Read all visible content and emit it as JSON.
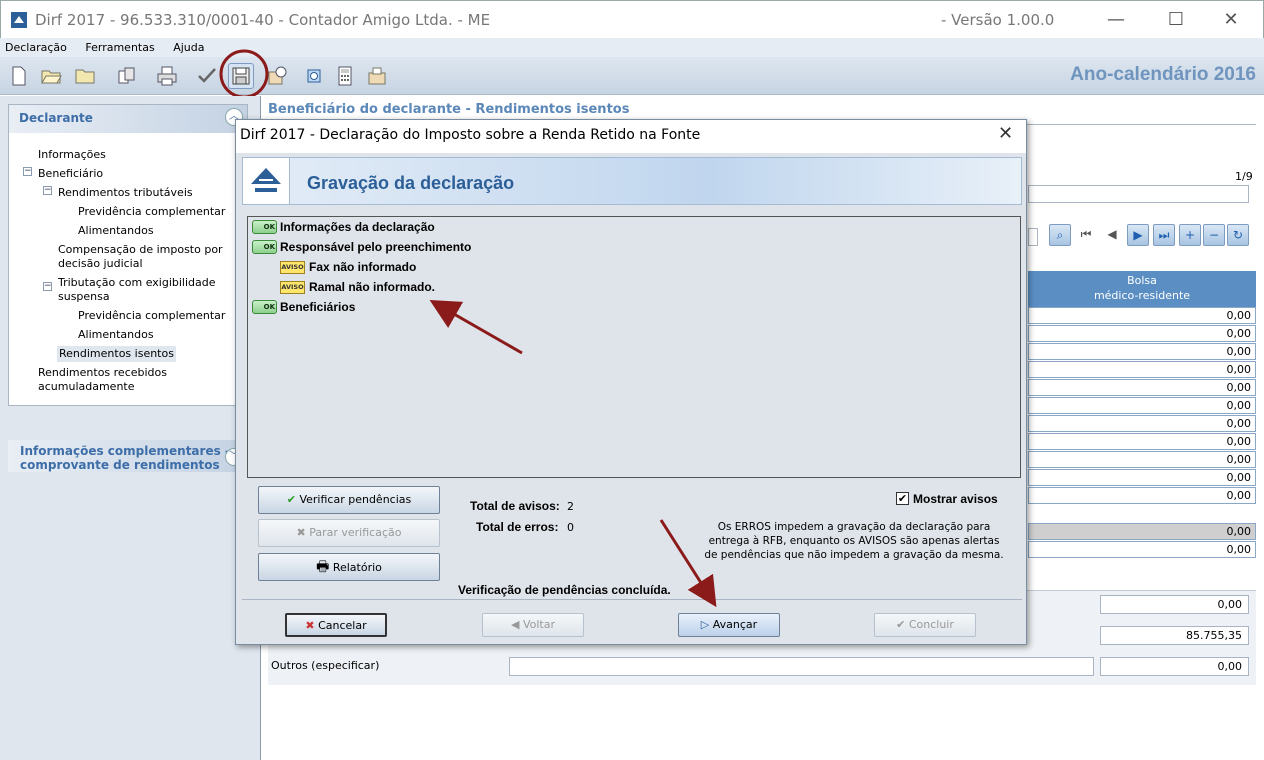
{
  "window": {
    "title": "Dirf 2017 - 96.533.310/0001-40 - Contador Amigo Ltda. - ME",
    "version": "- Versão  1.00.0",
    "minimize": "—",
    "maximize": "☐",
    "close": "✕"
  },
  "menu": [
    "Declaração",
    "Ferramentas",
    "Ajuda"
  ],
  "toolbar": {
    "year_label": "Ano-calendário 2016",
    "icons": [
      "new-file-icon",
      "open-folder-icon",
      "folder-icon",
      "copy-icon",
      "print-icon",
      "check-icon",
      "save-icon",
      "export-icon",
      "search-icon",
      "calculator-icon",
      "transmit-icon"
    ]
  },
  "sidebar": {
    "declarante_header": "Declarante",
    "tree": [
      "Informações",
      "Beneficiário",
      "Rendimentos tributáveis",
      "Previdência complementar",
      "Alimentandos",
      "Compensação de imposto por",
      "decisão judicial",
      "Tributação com exigibilidade",
      "suspensa",
      "Previdência complementar",
      "Alimentandos",
      "Rendimentos isentos",
      "Rendimentos recebidos",
      "acumuladamente"
    ],
    "info_header_line1": "Informações complementares -",
    "info_header_line2": "comprovante de rendimentos"
  },
  "background": {
    "heading": "Beneficiário do declarante - Rendimentos isentos",
    "page_counter": "1/9",
    "column_header_line1": "Bolsa",
    "column_header_line2": "médico-residente",
    "column_values": [
      "0,00",
      "0,00",
      "0,00",
      "0,00",
      "0,00",
      "0,00",
      "0,00",
      "0,00",
      "0,00",
      "0,00",
      "0,00",
      "0,00",
      "0,00"
    ],
    "field_value_1": "0,00",
    "field_value_2": "85.755,35",
    "outros_label": "Outros (especificar)",
    "outros_value": "0,00"
  },
  "dialog": {
    "title": "Dirf 2017 - Declaração do Imposto sobre a Renda Retido na Fonte",
    "close": "✕",
    "banner_title": "Gravação da declaração",
    "badge_ok": "OK",
    "badge_aviso": "AVISO",
    "items": {
      "info": "Informações da declaração",
      "resp": "Responsável pelo preenchimento",
      "fax": "Fax não informado",
      "ramal": "Ramal não informado.",
      "benef": "Beneficiários"
    },
    "buttons": {
      "verificar": "Verificar pendências",
      "parar": "Parar verificação",
      "relatorio": "Relatório",
      "cancelar": "Cancelar",
      "voltar": "Voltar",
      "avancar": "Avançar",
      "concluir": "Concluir"
    },
    "total_avisos_label": "Total de avisos:",
    "total_avisos_value": "2",
    "total_erros_label": "Total de erros:",
    "total_erros_value": "0",
    "mostrar_avisos": "Mostrar avisos",
    "note": "Os ERROS impedem a gravação da declaração para entrega à RFB, enquanto os AVISOS são apenas alertas de pendências que não impedem a gravação da mesma.",
    "status": "Verificação de pendências concluída."
  },
  "colors": {
    "accent_blue": "#2c5f98",
    "annotation_red": "#8b1a1a"
  }
}
